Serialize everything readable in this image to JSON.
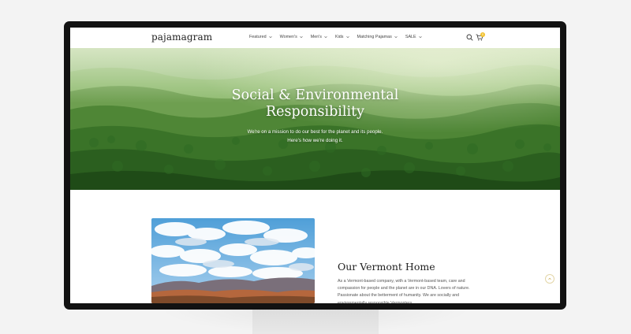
{
  "header": {
    "logo": "pajamagram",
    "nav": [
      {
        "label": "Featured"
      },
      {
        "label": "Women's"
      },
      {
        "label": "Men's"
      },
      {
        "label": "Kids"
      },
      {
        "label": "Matching Pajamas"
      },
      {
        "label": "SALE"
      }
    ],
    "cart_count": "0"
  },
  "hero": {
    "title_line1": "Social & Environmental",
    "title_line2": "Responsibility",
    "subtitle_line1": "We're on a mission to do our best for the planet and its people.",
    "subtitle_line2": "Here's how we're doing it."
  },
  "about": {
    "title": "Our Vermont Home",
    "body": "As a Vermont-based company, with a Vermont-based team, care and compassion for people and the planet are in our DNA. Lovers of nature. Passionate about the betterment of humanity. We are socially and environmentally responsible Vermonters."
  },
  "colors": {
    "badge": "#f2c230",
    "bezel": "#121212",
    "forest": "#2f6a24"
  },
  "icons": {
    "search": "search-icon",
    "cart": "cart-icon",
    "scroll_top": "chevron-up-icon"
  }
}
